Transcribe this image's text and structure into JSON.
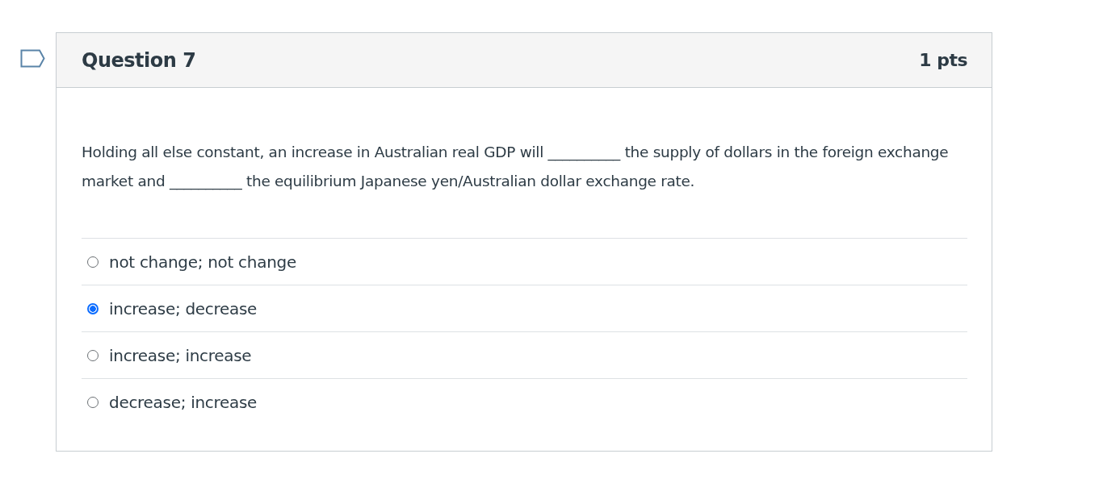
{
  "question": {
    "title": "Question 7",
    "points": "1 pts",
    "text": "Holding all else constant, an increase in Australian real GDP will __________ the supply of dollars in the foreign exchange market and __________ the equilibrium Japanese yen/Australian dollar exchange rate.",
    "answers": [
      {
        "label": "not change; not change",
        "selected": false
      },
      {
        "label": "increase; decrease",
        "selected": true
      },
      {
        "label": "increase; increase",
        "selected": false
      },
      {
        "label": "decrease; increase",
        "selected": false
      }
    ]
  }
}
